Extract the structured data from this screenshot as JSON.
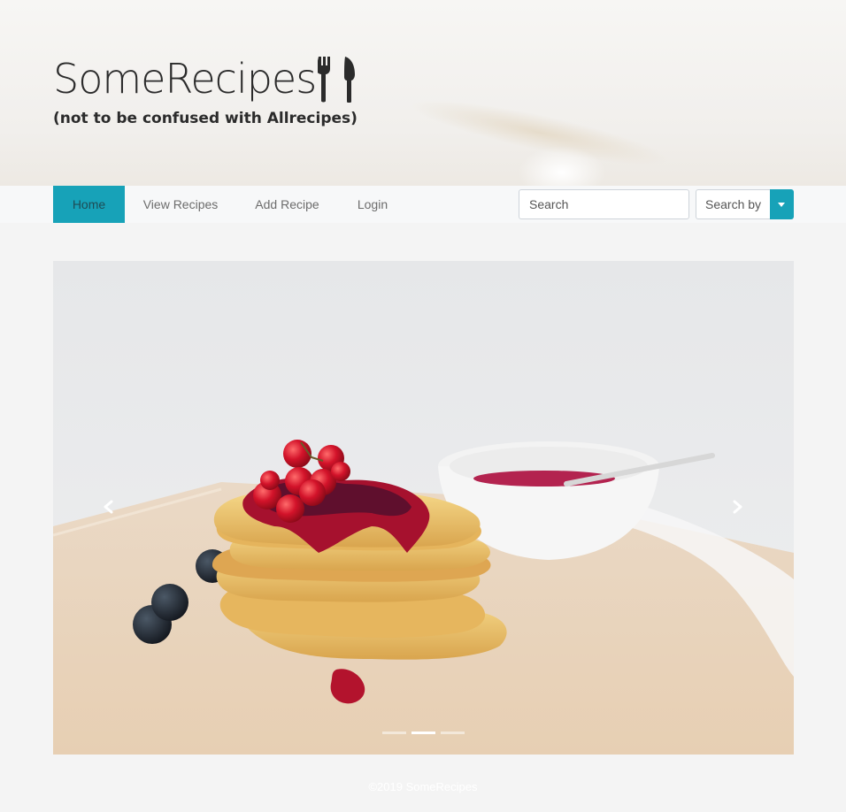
{
  "header": {
    "title": "SomeRecipes",
    "subtitle": "(not to be confused with Allrecipes)",
    "title_icon": "utensils-icon"
  },
  "nav": {
    "items": [
      {
        "label": "Home",
        "active": true
      },
      {
        "label": "View Recipes",
        "active": false
      },
      {
        "label": "Add Recipe",
        "active": false
      },
      {
        "label": "Login",
        "active": false
      }
    ],
    "search": {
      "placeholder": "Search",
      "value": ""
    },
    "search_by": {
      "label": "Search by",
      "toggle_icon": "caret-down-icon"
    }
  },
  "carousel": {
    "image": "waffles-with-berries",
    "prev_icon": "chevron-left-icon",
    "next_icon": "chevron-right-icon",
    "slide_count": 3,
    "active_slide": 2
  },
  "footer": {
    "text": "©2019 SomeRecipes"
  },
  "colors": {
    "accent": "#17a2b8",
    "background": "#f4f4f4",
    "navbar": "#f7f8f9"
  }
}
